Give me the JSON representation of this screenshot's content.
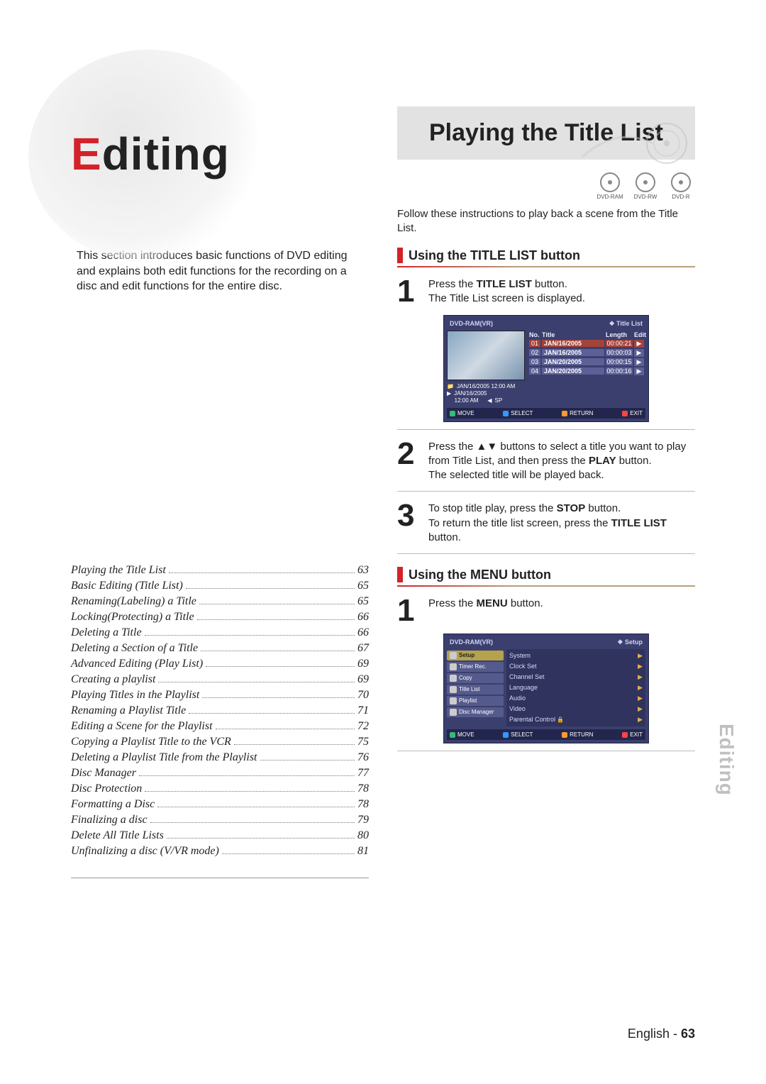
{
  "side_tab": "Editing",
  "chapter": {
    "accent_letter": "E",
    "rest": "diting"
  },
  "intro": "This section introduces basic functions of DVD editing and explains both edit functions for the recording on a disc and edit functions for the entire disc.",
  "toc": [
    {
      "label": "Playing the Title List",
      "page": "63"
    },
    {
      "label": "Basic Editing (Title List)",
      "page": "65"
    },
    {
      "label": "Renaming(Labeling) a Title",
      "page": "65"
    },
    {
      "label": "Locking(Protecting) a Title",
      "page": "66"
    },
    {
      "label": "Deleting a Title",
      "page": "66"
    },
    {
      "label": "Deleting a Section of a Title",
      "page": "67"
    },
    {
      "label": "Advanced Editing (Play List)",
      "page": "69"
    },
    {
      "label": "Creating a playlist",
      "page": "69"
    },
    {
      "label": "Playing Titles in the Playlist",
      "page": "70"
    },
    {
      "label": "Renaming a Playlist Title",
      "page": "71"
    },
    {
      "label": "Editing a Scene for the Playlist",
      "page": "72"
    },
    {
      "label": "Copying a Playlist Title to the VCR",
      "page": "75"
    },
    {
      "label": "Deleting a Playlist Title from the Playlist",
      "page": "76"
    },
    {
      "label": "Disc Manager",
      "page": "77"
    },
    {
      "label": "Disc Protection",
      "page": "78"
    },
    {
      "label": "Formatting a Disc",
      "page": "78"
    },
    {
      "label": "Finalizing a disc",
      "page": "79"
    },
    {
      "label": "Delete All Title Lists",
      "page": "80"
    },
    {
      "label": "Unfinalizing a disc (V/VR mode)",
      "page": "81"
    }
  ],
  "right": {
    "title": "Playing the Title List",
    "discs": [
      "DVD-RAM",
      "DVD-RW",
      "DVD-R"
    ],
    "intro": "Follow these instructions to play back a scene from the Title List.",
    "sub1": "Using the TITLE LIST button",
    "step1a": "Press the ",
    "step1b": "TITLE LIST",
    "step1c": " button.",
    "step1d": "The Title List screen is displayed.",
    "step2": "Press the ▲▼ buttons to select a title you want to play from Title List, and then press the ",
    "step2b": "PLAY",
    "step2c": " button.",
    "step2d": "The selected title will be played back.",
    "step3a": "To stop title play, press the ",
    "step3b": "STOP",
    "step3c": " button.",
    "step3d": "To return the title list screen, press the ",
    "step3e": "TITLE LIST",
    "step3f": " button.",
    "sub2": "Using the MENU button",
    "m_step1a": "Press the ",
    "m_step1b": "MENU",
    "m_step1c": " button."
  },
  "osd1": {
    "left_label": "DVD-RAM(VR)",
    "right_label": "Title List",
    "cols": [
      "No.",
      "Title",
      "Length",
      "Edit"
    ],
    "rows": [
      {
        "no": "01",
        "title": "JAN/16/2005",
        "len": "00:00:21",
        "edit": "▶",
        "sel": true
      },
      {
        "no": "02",
        "title": "JAN/16/2005",
        "len": "00:00:03",
        "edit": "▶",
        "sel": false
      },
      {
        "no": "03",
        "title": "JAN/20/2005",
        "len": "00:00:15",
        "edit": "▶",
        "sel": false
      },
      {
        "no": "04",
        "title": "JAN/20/2005",
        "len": "00:00:16",
        "edit": "▶",
        "sel": false
      }
    ],
    "meta1": "JAN/16/2005 12:00 AM",
    "meta2a": "JAN/16/2005",
    "meta2b": "12:00 AM",
    "meta2c": "SP",
    "foot": {
      "move": "MOVE",
      "select": "SELECT",
      "ret": "RETURN",
      "exit": "EXIT"
    }
  },
  "osd2": {
    "left_label": "DVD-RAM(VR)",
    "right_label": "Setup",
    "menu": [
      "Setup",
      "Timer Rec.",
      "Copy",
      "Title List",
      "Playlist",
      "Disc Manager"
    ],
    "items": [
      "System",
      "Clock Set",
      "Channel Set",
      "Language",
      "Audio",
      "Video",
      "Parental Control"
    ],
    "foot": {
      "move": "MOVE",
      "select": "SELECT",
      "ret": "RETURN",
      "exit": "EXIT"
    }
  },
  "footer": {
    "lang": "English",
    "dash": " - ",
    "page": "63"
  }
}
